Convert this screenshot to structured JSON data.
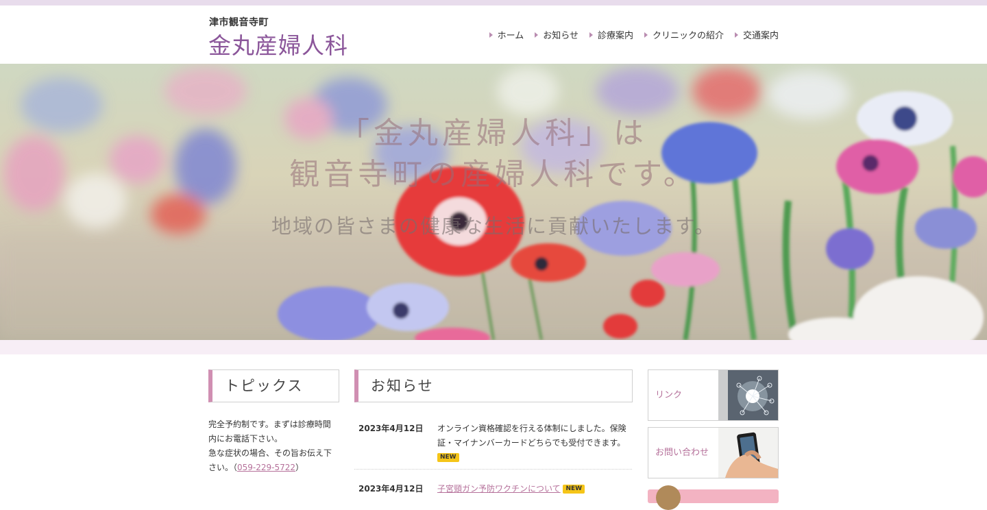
{
  "header": {
    "location": "津市観音寺町",
    "clinic_name": "金丸産婦人科",
    "nav": [
      {
        "label": "ホーム"
      },
      {
        "label": "お知らせ"
      },
      {
        "label": "診療案内"
      },
      {
        "label": "クリニックの紹介"
      },
      {
        "label": "交通案内"
      }
    ]
  },
  "hero": {
    "line1": "「金丸産婦人科」は",
    "line2": "観音寺町の産婦人科です。",
    "tagline": "地域の皆さまの健康な生活に貢献いたします。"
  },
  "topics": {
    "title": "トピックス",
    "text1": "完全予約制です。まずは診療時間内にお電話下さい。",
    "text2": "急な症状の場合、その旨お伝え下さい。（",
    "phone": "059-229-5722",
    "text3": "）"
  },
  "news": {
    "title": "お知らせ",
    "items": [
      {
        "date": "2023年4月12日",
        "text": "オンライン資格確認を行える体制にしました。保険証・マイナンバーカードどちらでも受付できます。",
        "badge": "NEW"
      },
      {
        "date": "2023年4月12日",
        "text": "子宮頸ガン予防ワクチンについて",
        "badge": "NEW"
      }
    ]
  },
  "sidebar": {
    "links": [
      {
        "label": "リンク",
        "icon": "medical-network-image"
      },
      {
        "label": "お問い合わせ",
        "icon": "smartphone-hand-image"
      }
    ]
  },
  "colors": {
    "brand_purple": "#8b569a",
    "accent_pink": "#d08fb2",
    "link_pink": "#b5709a",
    "badge_yellow": "#f5c518"
  }
}
